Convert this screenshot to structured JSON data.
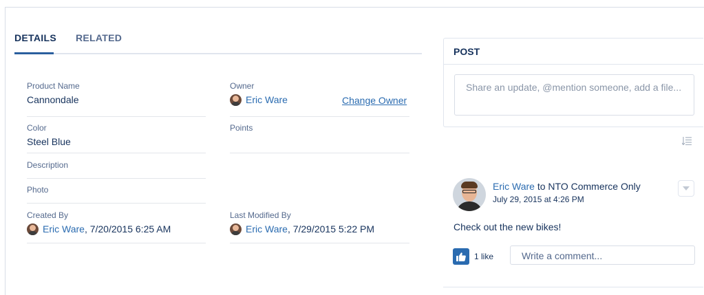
{
  "tabs": [
    {
      "label": "DETAILS",
      "active": true
    },
    {
      "label": "RELATED",
      "active": false
    }
  ],
  "details": {
    "product_name": {
      "label": "Product Name",
      "value": "Cannondale"
    },
    "owner": {
      "label": "Owner",
      "value": "Eric Ware",
      "action": "Change Owner"
    },
    "color": {
      "label": "Color",
      "value": "Steel Blue"
    },
    "points": {
      "label": "Points",
      "value": ""
    },
    "description": {
      "label": "Description",
      "value": ""
    },
    "photo": {
      "label": "Photo",
      "value": ""
    },
    "created_by": {
      "label": "Created By",
      "user": "Eric Ware",
      "timestamp": ", 7/20/2015 6:25 AM"
    },
    "last_modified_by": {
      "label": "Last Modified By",
      "user": "Eric Ware",
      "timestamp": ", 7/29/2015 5:22 PM"
    }
  },
  "post": {
    "title": "POST",
    "placeholder": "Share an update, @mention someone, add a file..."
  },
  "feed": {
    "author": "Eric Ware",
    "target_prefix": " to ",
    "target": "NTO Commerce Only",
    "date": "July 29, 2015 at 4:26 PM",
    "body": "Check out the new bikes!",
    "likes": "1 like",
    "comment_placeholder": "Write a comment..."
  },
  "colors": {
    "text": "#16325c",
    "link": "#2a6bb0",
    "label": "#54698d",
    "border": "#d8dde6"
  },
  "icons": [
    "avatar",
    "sort-icon",
    "like-icon",
    "dropdown-icon"
  ]
}
